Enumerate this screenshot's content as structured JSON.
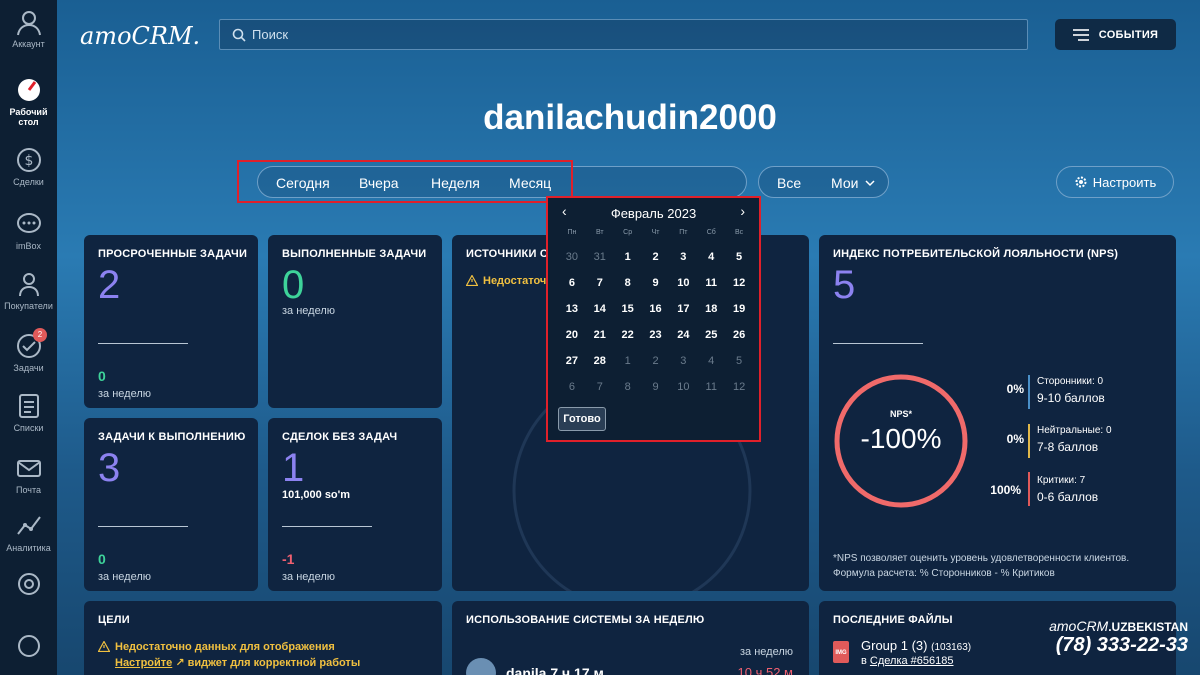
{
  "sidebar": {
    "items": [
      {
        "label": "Аккаунт"
      },
      {
        "label": "Рабочий стол",
        "label2": "стол",
        "label1": "Рабочий"
      },
      {
        "label": "Сделки"
      },
      {
        "label": "imBox"
      },
      {
        "label": "Покупатели"
      },
      {
        "label": "Задачи",
        "badge": "2"
      },
      {
        "label": "Списки"
      },
      {
        "label": "Почта"
      },
      {
        "label": "Аналитика"
      }
    ]
  },
  "header": {
    "logo": "amoCRM.",
    "search_placeholder": "Поиск",
    "events_label": "СОБЫТИЯ"
  },
  "username": "danilachudin2000",
  "filters": {
    "periods": [
      "Сегодня",
      "Вчера",
      "Неделя",
      "Месяц"
    ],
    "scope_all": "Все",
    "scope_mine": "Мои",
    "setup_label": "Настроить"
  },
  "calendar": {
    "month_label": "Февраль 2023",
    "weekdays": [
      "Пн",
      "Вт",
      "Ср",
      "Чт",
      "Пт",
      "Сб",
      "Вс"
    ],
    "weeks": [
      [
        "30",
        "31",
        "1",
        "2",
        "3",
        "4",
        "5"
      ],
      [
        "6",
        "7",
        "8",
        "9",
        "10",
        "11",
        "12"
      ],
      [
        "13",
        "14",
        "15",
        "16",
        "17",
        "18",
        "19"
      ],
      [
        "20",
        "21",
        "22",
        "23",
        "24",
        "25",
        "26"
      ],
      [
        "27",
        "28",
        "1",
        "2",
        "3",
        "4",
        "5"
      ],
      [
        "6",
        "7",
        "8",
        "9",
        "10",
        "11",
        "12"
      ]
    ],
    "done_label": "Готово"
  },
  "cards": {
    "overdue": {
      "title": "ПРОСРОЧЕННЫЕ ЗАДАЧИ",
      "value": "2",
      "small_value": "0",
      "small_sub": "за неделю"
    },
    "completed": {
      "title": "ВЫПОЛНЕННЫЕ ЗАДАЧИ",
      "value": "0",
      "sub": "за неделю"
    },
    "sources": {
      "title": "ИСТОЧНИКИ СД",
      "warning": "Недостаточн"
    },
    "todo": {
      "title": "ЗАДАЧИ К ВЫПОЛНЕНИЮ",
      "value": "3",
      "small_value": "0",
      "small_sub": "за неделю"
    },
    "no_tasks": {
      "title": "СДЕЛОК БЕЗ ЗАДАЧ",
      "value": "1",
      "amount": "101,000 so'm",
      "small_value": "-1",
      "small_sub": "за неделю"
    },
    "nps": {
      "title": "ИНДЕКС ПОТРЕБИТЕЛЬСКОЙ ЛОЯЛЬНОСТИ (NPS)",
      "value": "5",
      "gauge_label": "NPS*",
      "gauge_value": "-100%",
      "rows": [
        {
          "pct": "0%",
          "name": "Сторонники: 0",
          "range": "9-10 баллов",
          "color": "#4a90c8"
        },
        {
          "pct": "0%",
          "name": "Нейтральные: 0",
          "range": "7-8 баллов",
          "color": "#e0b84a"
        },
        {
          "pct": "100%",
          "name": "Критики: 7",
          "range": "0-6 баллов",
          "color": "#e05a5a"
        }
      ],
      "footnote1": "*NPS позволяет оценить уровень удовлетворенности клиентов.",
      "footnote2": "Формула расчета: % Сторонников - % Критиков"
    },
    "goals": {
      "title": "ЦЕЛИ",
      "warning": "Недостаточно данных для отображения",
      "link": "Настройте",
      "rest": "виджет для корректной работы"
    },
    "usage": {
      "title": "ИСПОЛЬЗОВАНИЕ СИСТЕМЫ ЗА НЕДЕЛЮ",
      "user": "danila 7 ч 17 м",
      "period": "за неделю",
      "total": "10 ч 52 м"
    },
    "files": {
      "title": "ПОСЛЕДНИЕ ФАЙЛЫ",
      "file_name": "Group 1 (3)",
      "file_id": "(103163)",
      "prefix": "в",
      "deal_link": "Сделка #656185",
      "file_ext": "IMG"
    }
  },
  "watermark": {
    "brand": "amoCRM",
    "suffix": ".UZBEKISTAN",
    "phone": "(78) 333-22-33"
  },
  "colors": {
    "purple": "#8c82f0",
    "green": "#3ed39a",
    "red": "#f06070",
    "warning": "#f0c040"
  }
}
